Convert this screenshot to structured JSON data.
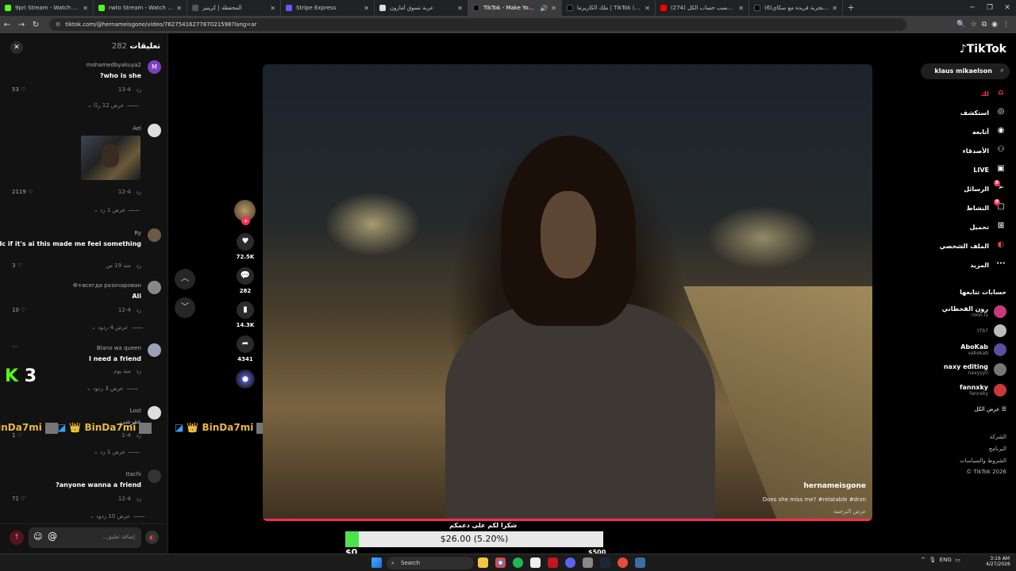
{
  "tabs": [
    {
      "title": "9prI Stream - Watch Live on Ki",
      "favicon_color": "#53fc18",
      "active": false
    },
    {
      "title": "rwto Stream - Watch Live on Ki",
      "favicon_color": "#53fc18",
      "active": false
    },
    {
      "title": "المحفظة | كريتيز",
      "favicon_color": "#555555",
      "active": false
    },
    {
      "title": "Stripe Express",
      "favicon_color": "#635bff",
      "active": false
    },
    {
      "title": "عربة تسوق أمازون",
      "favicon_color": "#dddddd",
      "active": false
    },
    {
      "title": "TikTok - Make Your Day",
      "favicon_color": "#000000",
      "active": true
    },
    {
      "title": "ملك الكاريزما | TikTok (77)tuiq",
      "favicon_color": "#000000",
      "active": false
    },
    {
      "title": "انا احسب حساب الكل (274) ...be",
      "favicon_color": "#ff0000",
      "active": false
    },
    {
      "title": "(6)استمتع بتجربة فريدة مع سكاي",
      "favicon_color": "#000000",
      "active": false
    }
  ],
  "url": "tiktok.com/@hernameisgone/video/7627541627787021598?lang=ar",
  "comments_panel": {
    "title": "تعليقات",
    "count": "282",
    "items": [
      {
        "username": "mohamedbyakuya2",
        "text": "?who is she",
        "date": "4-13",
        "reply": "رد",
        "likes": "53",
        "replies_label": "عرض 12 ردًا",
        "avatar_letter": "M",
        "avatar_color": "#7b3fc2"
      },
      {
        "username": "Ael",
        "text": "",
        "date": "4-12",
        "reply": "رد",
        "likes": "2119",
        "replies_label": "عرض 1 رد",
        "avatar_letter": "",
        "avatar_color": "#cccccc"
      },
      {
        "username": "Ry",
        "text": "Idc if it's ai this made me feel something",
        "date": "منذ 19 س",
        "reply": "رد",
        "likes": "3",
        "replies_label": "",
        "avatar_letter": "",
        "avatar_color": "#6b5a48"
      },
      {
        "username": "Ф+всегда разочарован",
        "text": "Ali",
        "date": "4-12",
        "reply": "رد",
        "likes": "10",
        "replies_label": "عرض 4 ردود",
        "avatar_letter": "",
        "avatar_color": "#888888"
      },
      {
        "username": "Blano wa queen",
        "text": "I need a friend",
        "date": "منذ يوم",
        "reply": "رد",
        "likes": "",
        "replies_label": "عرض 3 ردود",
        "avatar_letter": "",
        "avatar_color": "#9aa0b8"
      },
      {
        "username": "Lost",
        "text": "عقرشي",
        "date": "4-1",
        "reply": "رد",
        "likes": "1",
        "replies_label": "عرض 1 رد",
        "avatar_letter": "",
        "avatar_color": "#dddddd"
      },
      {
        "username": "Itachi",
        "text": "?anyone wanna a friend",
        "date": "4-12",
        "reply": "رد",
        "likes": "71",
        "replies_label": "عرض 10 ردود",
        "avatar_letter": "",
        "avatar_color": "#444444"
      }
    ],
    "input_placeholder": "إضافة تعليق..."
  },
  "overlay": {
    "kick_score": "3",
    "banner_name": "BinDa7mi"
  },
  "video": {
    "author": "hernameisgone",
    "caption": "Does she miss me? #relatable #drzn",
    "translate": "عرض الترجمة",
    "progress": 1.0
  },
  "actions": {
    "likes": "72.5K",
    "comments": "282",
    "saves": "14.3K",
    "shares": "4341"
  },
  "sidebar": {
    "logo": "TikTok",
    "search_value": "klaus mikaelson",
    "nav": [
      {
        "label": "لك",
        "icon": "home-icon",
        "badge": ""
      },
      {
        "label": "استكشف",
        "icon": "compass-icon",
        "badge": ""
      },
      {
        "label": "أتابعه",
        "icon": "following-icon",
        "badge": ""
      },
      {
        "label": "الأصدقاء",
        "icon": "friends-icon",
        "badge": ""
      },
      {
        "label": "LIVE",
        "icon": "live-icon",
        "badge": ""
      },
      {
        "label": "الرسائل",
        "icon": "messages-icon",
        "badge": "9"
      },
      {
        "label": "النشاط",
        "icon": "activity-icon",
        "badge": "9"
      },
      {
        "label": "تحميل",
        "icon": "upload-icon",
        "badge": ""
      },
      {
        "label": "الملف الشخصي",
        "icon": "profile-icon",
        "badge": ""
      },
      {
        "label": "المزيد",
        "icon": "more-icon",
        "badge": ""
      }
    ],
    "following_title": "حسابات تتابعها",
    "following": [
      {
        "name": "رون القحطاني",
        "handle": "ronn.l1",
        "color": "#c83a7a"
      },
      {
        "name": "",
        "handle": "t7b7",
        "color": "#bbbbbb"
      },
      {
        "name": "AboKab",
        "handle": "vabokab",
        "color": "#5a4fa0"
      },
      {
        "name": "naxy editing",
        "handle": "naxyyy0",
        "color": "#777777"
      },
      {
        "name": "fannxky",
        "handle": "fannxky",
        "color": "#c83a3a"
      }
    ],
    "see_all": "عرض الكل",
    "footer": [
      "الشركة",
      "البرنامج",
      "الشروط والسياسات",
      "© TikTok 2026"
    ]
  },
  "donation": {
    "title": "شكرا لكم على دعمكم",
    "amount": "$26.00 (5.20%)",
    "fill_percent": 5.2,
    "min": "$0",
    "max": "$500"
  },
  "taskbar": {
    "search": "Search",
    "lang": "ENG",
    "time": "3:16 AM",
    "date": "4/27/2026"
  }
}
